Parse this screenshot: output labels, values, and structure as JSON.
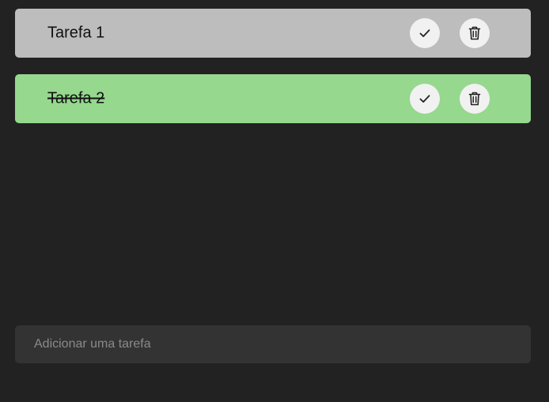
{
  "tasks": [
    {
      "label": "Tarefa 1",
      "completed": false,
      "color": "#bdbdbd",
      "check_icon": "check-icon",
      "delete_icon": "trash-icon"
    },
    {
      "label": "Tarefa 2",
      "completed": true,
      "color": "#95d88e",
      "check_icon": "check-icon",
      "delete_icon": "trash-icon"
    }
  ],
  "add_task": {
    "placeholder": "Adicionar uma tarefa",
    "value": ""
  },
  "colors": {
    "background": "#222222",
    "input_background": "#333333",
    "button_background": "#f1f1f1"
  }
}
